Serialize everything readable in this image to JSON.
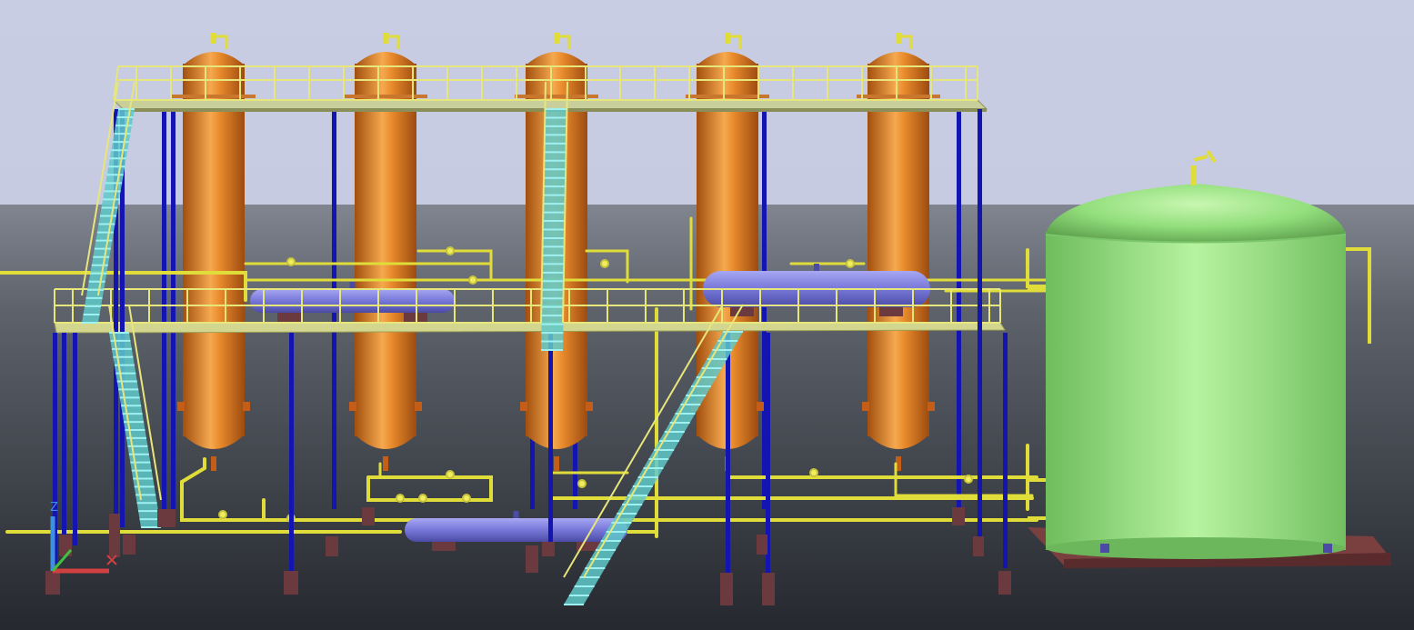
{
  "viewport": {
    "sky_color": "#c9cde3",
    "horizon_color": "#80858f",
    "ground_color": "#2b2e35"
  },
  "colors": {
    "column_vessel": "#d9731f",
    "column_highlight": "#f6a94f",
    "horizontal_drum": "#6f6fd0",
    "drum_highlight": "#a7a7f2",
    "storage_tank": "#8fdc7a",
    "tank_highlight": "#bdf5a6",
    "steel_column": "#1414b0",
    "handrail": "#e6e67a",
    "stair_tread": "#6fd6d6",
    "piping": "#e0dc3a",
    "foundation": "#6b3a3f",
    "tank_base": "#7a3f3f"
  },
  "equipment": {
    "columns": [
      {
        "name": "column-1"
      },
      {
        "name": "column-2"
      },
      {
        "name": "column-3"
      },
      {
        "name": "column-4"
      },
      {
        "name": "column-5"
      }
    ],
    "drums": [
      {
        "name": "drum-left"
      },
      {
        "name": "drum-right"
      },
      {
        "name": "drum-lower"
      }
    ],
    "tank": {
      "name": "storage-tank"
    }
  },
  "ucs_icon": {
    "axis_z": "Z",
    "axis_x_color": "#d04040",
    "axis_y_color": "#40c040",
    "axis_z_color": "#4090e0"
  }
}
